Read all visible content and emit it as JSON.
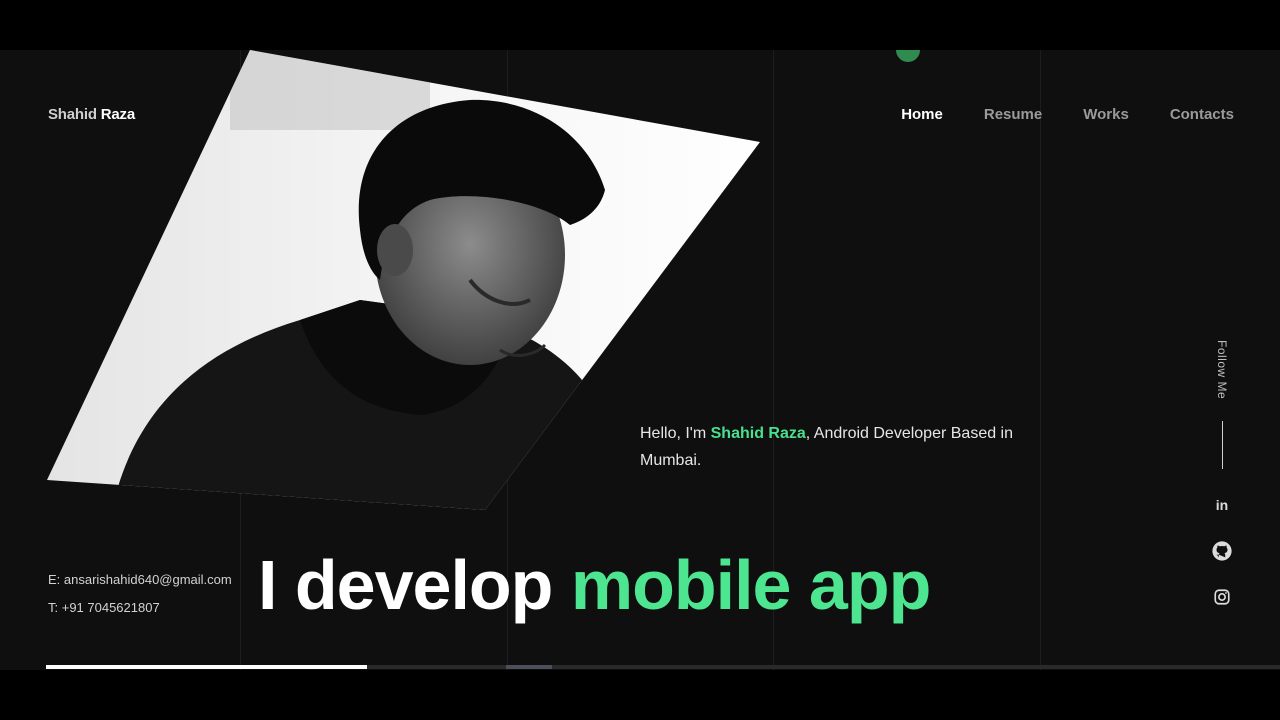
{
  "header": {
    "logo_first": "Shahid",
    "logo_last": "Raza",
    "nav": [
      {
        "label": "Home",
        "active": true
      },
      {
        "label": "Resume",
        "active": false
      },
      {
        "label": "Works",
        "active": false
      },
      {
        "label": "Contacts",
        "active": false
      }
    ]
  },
  "hero": {
    "intro_prefix": "Hello, I'm ",
    "intro_name": "Shahid Raza",
    "intro_suffix": ", Android Developer Based in Mumbai.",
    "headline_prefix": "I develop ",
    "headline_accent": "mobile app"
  },
  "contact": {
    "email": "E: ansarishahid640@gmail.com",
    "phone": "T: +91 7045621807"
  },
  "follow": {
    "label": "Follow Me",
    "linkedin": "in",
    "icons": [
      "linkedin-icon",
      "github-icon",
      "instagram-icon"
    ]
  },
  "slider_progress": 0.26,
  "colors": {
    "accent": "#4de58f",
    "background": "#0f0f10",
    "dot": "#2f8b4f"
  }
}
